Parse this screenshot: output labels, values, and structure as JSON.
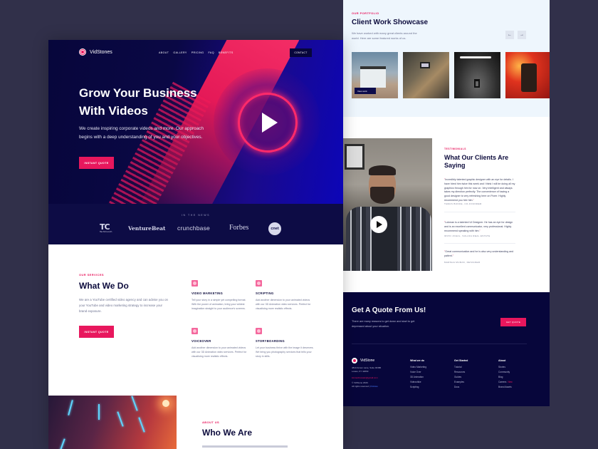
{
  "brand": {
    "name": "VidStones",
    "accent": "#e8175d",
    "navy": "#07063b"
  },
  "nav": {
    "links": [
      "About",
      "Gallery",
      "Pricing",
      "FAQ",
      "Benefits"
    ],
    "contact_label": "Contact"
  },
  "hero": {
    "title": "Grow Your Business With Videos",
    "subtitle": "We create inspiring corporate videos and more. Our approach begins with a deep understanding of you and your objectives.",
    "cta_label": "Instant Quote",
    "play_icon": "play-icon"
  },
  "news": {
    "label": "In the news",
    "logos": [
      "TC",
      "TechCrunch",
      "VentureBeat",
      "crunchbase",
      "Forbes",
      "cnet"
    ]
  },
  "services": {
    "eyebrow": "Our Services",
    "title": "What We Do",
    "description": "We are a YouTube certified video agency and can advise you on your YouTube and video marketing strategy to increase your brand exposure.",
    "cta_label": "Instant Quote",
    "items": [
      {
        "title": "Video Marketing",
        "text": "Tell your story in a simple yet compelling format. With the power of animation, bring your wildest imagination straight to your audience's screens."
      },
      {
        "title": "Scripting",
        "text": "Add another dimension to your animated videos with our 3D Animation video services. Perfect for visualising more realistic effects."
      },
      {
        "title": "Voiceover",
        "text": "Add another dimension to your animated videos with our 3D Animation video services. Perfect for visualising more realistic effects."
      },
      {
        "title": "Storyboarding",
        "text": "Let your business thrive with the image it deserves. We bring you photography services that tells your story in stills."
      }
    ]
  },
  "about": {
    "eyebrow": "About Us",
    "title": "Who We Are"
  },
  "portfolio": {
    "eyebrow": "Our Portfolio",
    "title": "Client Work Showcase",
    "description": "We have worked with many great clients around the world. Here are some featured works of us.",
    "prev_label": "←",
    "next_label": "→",
    "view_work_label": "View work"
  },
  "testimonials": {
    "eyebrow": "Testimonials",
    "title": "What Our Clients Are Saying",
    "items": [
      {
        "quote": "Incredibly talented graphic designer with an eye for details. I have hired him twice this week and I think I will be doing all my graphics through him for now on. Very intelligent and always takes my direction perfectly. The convenience of having a good designer is very refreshing here on Fiverr. Highly recommend you hire him.",
        "author": "Tamas Bunce, CO-Founder"
      },
      {
        "quote": "Lokman is a talented UI Designer. He has an eye for design and is an excellent communicator, very professional. Highly recommend speaking with him.",
        "author": "Irvin Johal, Sulafa Real Estate"
      },
      {
        "quote": "Great communication and he is also very understanding and patient.",
        "author": "Marsha Murak, Designer"
      }
    ]
  },
  "quote_cta": {
    "title": "Get A Quote From Us!",
    "text": "There are many reasons to get down and start to get depressed about your situation.",
    "button_label": "Get Quote"
  },
  "footer": {
    "brand": "VidStone",
    "address": [
      "4813 Annen Lane, Suite 02386",
      "Lowes, KY 42063"
    ],
    "email": "lokmanhossain@gmail.com",
    "copyright": [
      "© VidStone 2020.",
      "All rights reserved"
    ],
    "policy_link": "Policies",
    "columns": [
      {
        "title": "What we do",
        "links": [
          "Video Marketing",
          "Voice Over",
          "3D Animation",
          "Videoshike",
          "Scripting"
        ]
      },
      {
        "title": "Get Started",
        "links": [
          "Tutorial",
          "Resources",
          "Guides",
          "Examples",
          "Docs"
        ]
      },
      {
        "title": "About",
        "links": [
          "Stories",
          "Community",
          "Blog",
          "Careers",
          "Brand Assets"
        ],
        "badge": {
          "index": 3,
          "label": "New"
        }
      }
    ]
  }
}
